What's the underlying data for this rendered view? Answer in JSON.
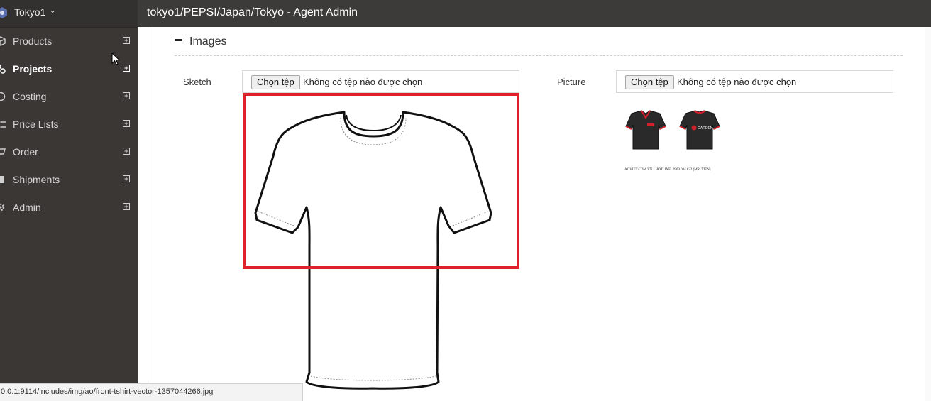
{
  "app": {
    "workspace": "Tokyo1"
  },
  "topbar": {
    "title": "tokyo1/PEPSI/Japan/Tokyo - Agent Admin"
  },
  "sidebar": {
    "items": [
      {
        "label": "Products",
        "icon": "cube-icon"
      },
      {
        "label": "Projects",
        "icon": "projects-icon",
        "active": true
      },
      {
        "label": "Costing",
        "icon": "costing-icon"
      },
      {
        "label": "Price Lists",
        "icon": "price-list-icon"
      },
      {
        "label": "Order",
        "icon": "order-icon"
      },
      {
        "label": "Shipments",
        "icon": "shipments-icon"
      },
      {
        "label": "Admin",
        "icon": "gear-icon"
      }
    ]
  },
  "section": {
    "title": "Images"
  },
  "sketch": {
    "label": "Sketch",
    "button": "Chọn tệp",
    "status": "Không có tệp nào được chọn"
  },
  "picture": {
    "label": "Picture",
    "button": "Chọn tệp",
    "status": "Không có tệp nào được chọn",
    "caption": "AOVIET.COM.VN - HOTLINE: 0969 084 822 (MR. TIEN)",
    "brand": "GARDEN"
  },
  "statusbar": {
    "url": "0.0.1:9114/includes/img/ao/front-tshirt-vector-1357044266.jpg"
  },
  "colors": {
    "highlight": "#e0202a",
    "sidebar": "#3a3735",
    "topbar": "#3d3b39"
  }
}
